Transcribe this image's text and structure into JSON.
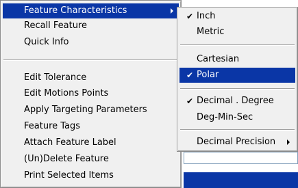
{
  "main_menu": {
    "items": [
      {
        "label": "Feature Characteristics"
      },
      {
        "label": "Recall Feature"
      },
      {
        "label": "Quick Info"
      },
      {
        "label": "Edit Tolerance"
      },
      {
        "label": "Edit Motions Points"
      },
      {
        "label": "Apply Targeting Parameters"
      },
      {
        "label": "Feature Tags"
      },
      {
        "label": "Attach Feature Label"
      },
      {
        "label": "(Un)Delete Feature"
      },
      {
        "label": "Print Selected Items"
      }
    ]
  },
  "sub_menu": {
    "items": [
      {
        "label": "Inch",
        "checked": true
      },
      {
        "label": "Metric",
        "checked": false
      },
      {
        "label": "Cartesian",
        "checked": false
      },
      {
        "label": "Polar",
        "checked": true
      },
      {
        "label": "Decimal . Degree",
        "checked": true
      },
      {
        "label": "Deg-Min-Sec",
        "checked": false
      },
      {
        "label": "Decimal Precision",
        "checked": false
      }
    ]
  },
  "glyphs": {
    "check": "✔"
  },
  "colors": {
    "highlight": "#0a36a6",
    "menu_bg": "#f0f0f0"
  }
}
